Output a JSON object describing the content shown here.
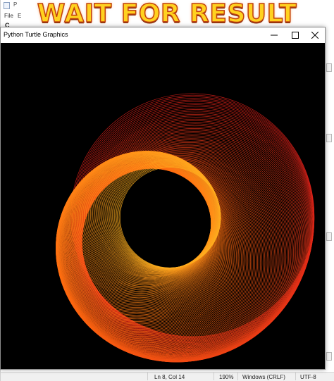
{
  "banner": {
    "text": "WAIT FOR RESULT"
  },
  "editor": {
    "title": "P",
    "menu": [
      "File",
      "E"
    ],
    "first_line": "C"
  },
  "turtle_window": {
    "title": "Python Turtle Graphics",
    "controls": [
      "minimize-icon",
      "maximize-icon",
      "close-icon"
    ],
    "canvas_background": "#000000",
    "colors": {
      "outer": "#e0201a",
      "mid": "#ff6a10",
      "inner": "#ffb020"
    }
  },
  "statusbar": {
    "position": "Ln 8, Col 14",
    "zoom": "190%",
    "line_ending": "Windows (CRLF)",
    "encoding": "UTF-8"
  }
}
